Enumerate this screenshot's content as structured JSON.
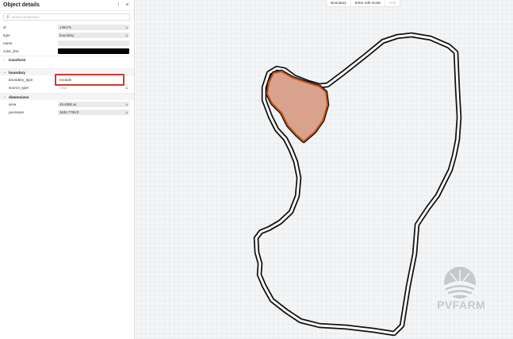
{
  "panel": {
    "title": "Object details",
    "menu_icon": "more-vertical-icon",
    "close_icon": "close-icon",
    "search_placeholder": "search properties"
  },
  "properties": {
    "id": {
      "label": "id",
      "value": "149175"
    },
    "type": {
      "label": "type",
      "value": "boundary"
    },
    "name": {
      "label": "name",
      "value": ""
    },
    "color_line": {
      "label": "color_line",
      "value": "#000000"
    }
  },
  "sections": {
    "transform": {
      "label": "transform"
    },
    "boundary": {
      "label": "boundary",
      "boundary_type": {
        "label": "boundary_type",
        "value": "exclude"
      },
      "source_type": {
        "label": "source_type",
        "value": "origin"
      }
    },
    "dimensions": {
      "label": "dimensions",
      "area": {
        "label": "area",
        "value": "49.4558 ac"
      },
      "perimeter": {
        "label": "perimeter",
        "value": "3636.7706 ft"
      }
    }
  },
  "toolbar": {
    "mode": "Boundary",
    "edit": "Enter edit mode",
    "third": "Edit"
  },
  "logo": {
    "text": "PVFARM"
  },
  "colors": {
    "exclude_fill": "#d9a28c",
    "exclude_stroke": "#c2541d",
    "highlight": "#d03a2f",
    "boundary_stroke": "#111111"
  }
}
